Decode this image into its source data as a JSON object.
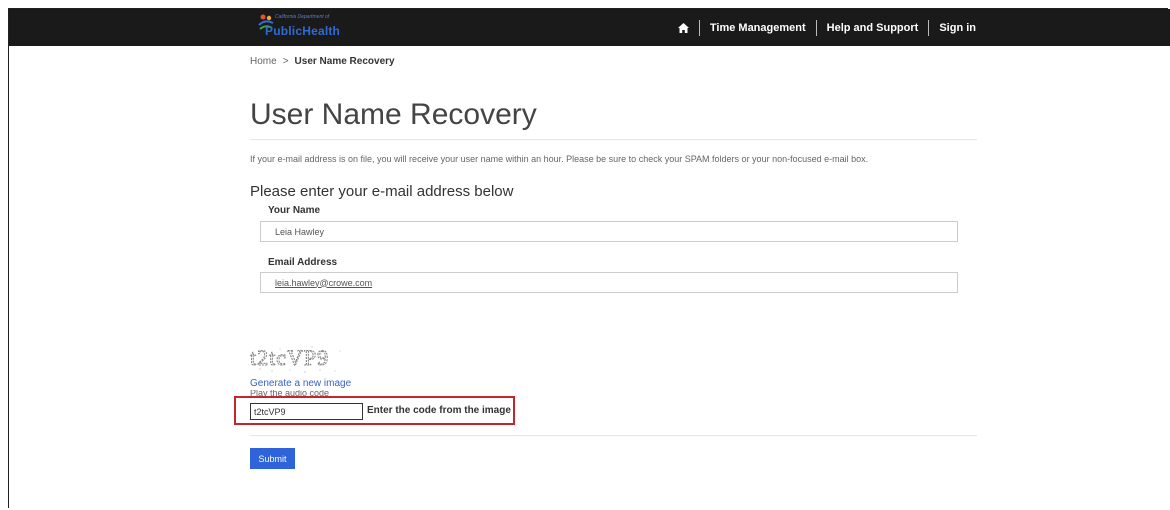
{
  "header": {
    "logo_small": "California Department of",
    "logo_main": "PublicHealth",
    "nav": {
      "time_management": "Time Management",
      "help_support": "Help and Support",
      "sign_in": "Sign in"
    }
  },
  "breadcrumb": {
    "home": "Home",
    "separator": ">",
    "current": "User Name Recovery"
  },
  "page": {
    "title": "User Name Recovery",
    "info": "If your e-mail address is on file, you will receive your user name within an hour. Please be sure to check your SPAM folders or your non-focused e-mail box.",
    "subtitle": "Please enter your e-mail address below"
  },
  "form": {
    "name_label": "Your Name",
    "name_value": "Leia Hawley",
    "email_label": "Email Address",
    "email_value": "leia.hawley@crowe.com",
    "captcha_text": "t2tcVP9",
    "generate_link": "Generate a new image",
    "audio_link": "Play the audio code",
    "code_value": "t2tcVP9",
    "code_label": "Enter the code from the image",
    "submit_label": "Submit"
  },
  "colors": {
    "navbar": "#1a1a1a",
    "submit": "#2e63d9",
    "highlight": "#c1272d",
    "link": "#3a63b8"
  }
}
